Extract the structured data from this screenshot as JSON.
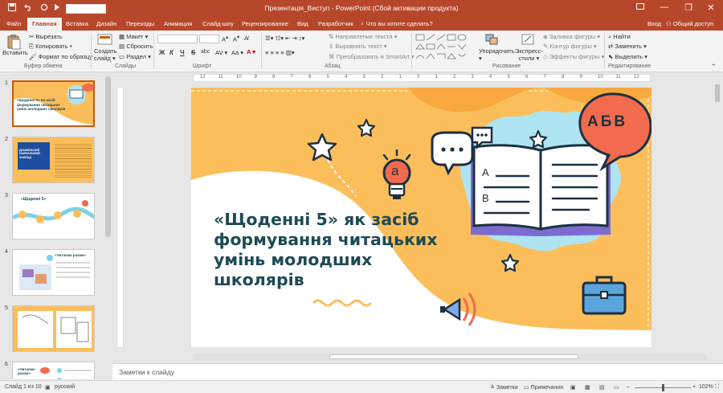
{
  "titlebar": {
    "title": "Презентація_Виступ - PowerPoint (Сбой активации продукта)",
    "save_icon": "save-icon",
    "undo_icon": "undo-icon",
    "redo_icon": "redo-icon",
    "present_icon": "present-icon",
    "controls": [
      "—",
      "❐",
      "✕"
    ]
  },
  "tabs": [
    "Файл",
    "Главная",
    "Вставка",
    "Дизайн",
    "Переходы",
    "Анимация",
    "Слайд-шоу",
    "Рецензирование",
    "Вид",
    "Разработчик"
  ],
  "active_tab": "Главная",
  "tellme": "Что вы хотите сделать?",
  "signin": "Вход",
  "share": "Общий доступ",
  "ribbon": {
    "paste": "Вставить",
    "cut": "Вырезать",
    "copy": "Копировать",
    "format_painter": "Формат по образцу",
    "clipboard_group": "Буфер обмена",
    "new_slide_line1": "Создать",
    "new_slide_line2": "слайд",
    "layout": "Макет",
    "reset": "Сбросить",
    "section": "Раздел",
    "slides_group": "Слайды",
    "font_group": "Шрифт",
    "paragraph_group": "Абзац",
    "text_direction": "Направление текста",
    "align_text": "Выровнять текст",
    "smartart": "Преобразовать в SmartArt",
    "arrange": "Упорядочить",
    "quick_styles_line1": "Экспресс-",
    "quick_styles_line2": "стили",
    "shape_fill": "Заливка фигуры",
    "shape_outline": "Контур фигуры",
    "shape_effects": "Эффекты фигуры",
    "drawing_group": "Рисование",
    "find": "Найти",
    "replace": "Заменить",
    "select": "Выделить",
    "editing_group": "Редактирование",
    "bold": "Ж",
    "italic": "К",
    "underline": "Ч",
    "strike": "S",
    "shadow": "abc"
  },
  "ruler": [
    "12",
    "11",
    "10",
    "9",
    "8",
    "7",
    "6",
    "5",
    "4",
    "3",
    "2",
    "1",
    "0",
    "1",
    "2",
    "3",
    "4",
    "5",
    "6",
    "7",
    "8",
    "9",
    "10",
    "11",
    "12"
  ],
  "thumbnails": [
    {
      "num": "1",
      "title": "«Щоденні 5» як засіб формування читацьких умінь молодших школярів"
    },
    {
      "num": "2",
      "title": "ДОШКІЛЬНИЙ НАВЧАЛЬНИЙ ЗАКЛАД"
    },
    {
      "num": "3",
      "title": "«Щоденні 5»"
    },
    {
      "num": "4",
      "title": "«Читаємо разом»"
    },
    {
      "num": "5",
      "title": ""
    },
    {
      "num": "6",
      "title": "«Читаємо разом»"
    }
  ],
  "slide": {
    "title": "«Щоденні 5» як засіб формування читацьких умінь молодших школярів",
    "bubble_text": "АБВ",
    "book_letter_a": "A",
    "book_letter_b": "B",
    "bulb_letter": "а",
    "colors": {
      "background": "#fcbe5a",
      "title": "#1d4a55",
      "accent": "#f26b4f",
      "blob": "#aee4f2"
    }
  },
  "notes_placeholder": "Заметки к слайду",
  "status": {
    "slide_info": "Слайд 1 из 10",
    "language": "русский",
    "notes": "Заметки",
    "comments": "Примечания",
    "zoom": "102%"
  }
}
